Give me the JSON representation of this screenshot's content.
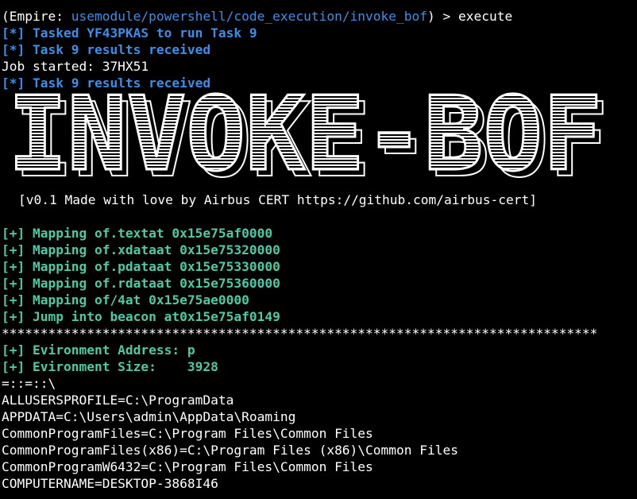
{
  "terminal": {
    "prompt": {
      "open": "(Empire: ",
      "module": "usemodule/powershell/code_execution/invoke_bof",
      "close": ") > ",
      "command": "execute"
    },
    "status_lines": [
      "[*] Tasked YF43PKAS to run Task 9",
      "[*] Task 9 results received"
    ],
    "job_started": "Job started: 37HX51",
    "status_after_job": "[*] Task 9 results received",
    "banner": {
      "logo_text": "INVOKE-BOF",
      "subtitle": "[v0.1 Made with love by Airbus CERT https://github.com/airbus-cert]"
    },
    "mapping_lines": [
      "[+] Mapping of.textat 0x15e75af0000",
      "[+] Mapping of.xdataat 0x15e75320000",
      "[+] Mapping of.pdataat 0x15e75330000",
      "[+] Mapping of.rdataat 0x15e75360000",
      "[+] Mapping of/4at 0x15e75ae0000",
      "[+] Jump into beacon at0x15e75af0149"
    ],
    "separator": "*****************************************************************************",
    "env_lines": [
      "[+] Evironment Address: p",
      "[+] Evironment Size:    3928"
    ],
    "env_output": [
      "=::=::\\",
      "ALLUSERSPROFILE=C:\\ProgramData",
      "APPDATA=C:\\Users\\admin\\AppData\\Roaming",
      "CommonProgramFiles=C:\\Program Files\\Common Files",
      "CommonProgramFiles(x86)=C:\\Program Files (x86)\\Common Files",
      "CommonProgramW6432=C:\\Program Files\\Common Files",
      "COMPUTERNAME=DESKTOP-3868I46"
    ],
    "colors": {
      "background": "#000000",
      "info_blue": "#3b8eea",
      "success_green": "#4ec9a6",
      "text": "#ffffff"
    }
  }
}
